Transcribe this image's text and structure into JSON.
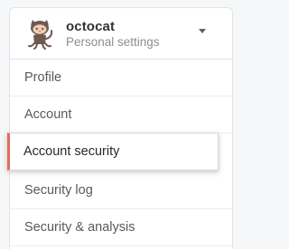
{
  "user": {
    "name": "octocat",
    "subtitle": "Personal settings",
    "avatar_icon": "octocat-avatar-icon"
  },
  "menu": {
    "items": [
      {
        "label": "Profile",
        "active": false
      },
      {
        "label": "Account",
        "active": false
      },
      {
        "label": "Account security",
        "active": true
      },
      {
        "label": "Security log",
        "active": false
      },
      {
        "label": "Security & analysis",
        "active": false
      }
    ]
  },
  "colors": {
    "active_accent": "#e36d5d",
    "text": "#555a60",
    "active_text": "#24292e",
    "border": "#e1e4e8"
  }
}
